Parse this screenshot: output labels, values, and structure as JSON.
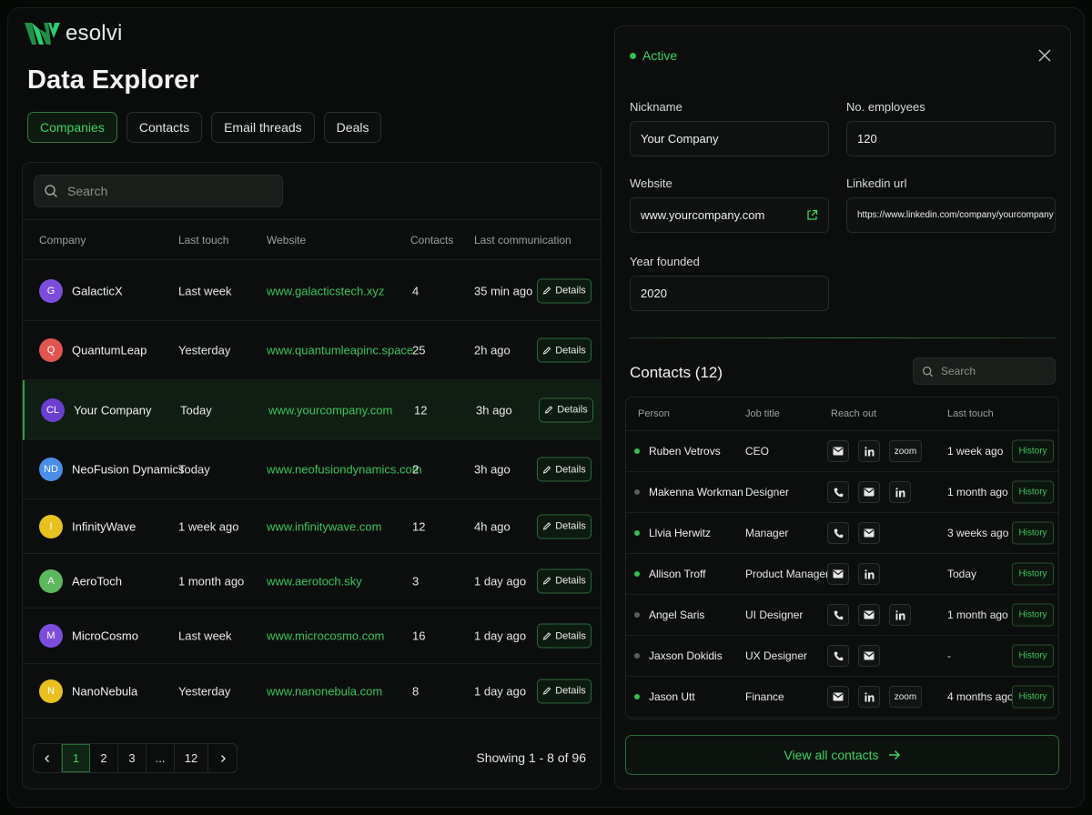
{
  "brand": {
    "name": "esolvi"
  },
  "page": {
    "title": "Data Explorer"
  },
  "tabs": [
    "Companies",
    "Contacts",
    "Email threads",
    "Deals"
  ],
  "table": {
    "search_placeholder": "Search",
    "columns": [
      "Company",
      "Last touch",
      "Website",
      "Contacts",
      "Last communication"
    ],
    "details_label": "Details",
    "rows": [
      {
        "initials": "G",
        "color": "#7c4ddb",
        "name": "GalacticX",
        "last_touch": "Last week",
        "website": "www.galacticstech.xyz",
        "contacts": "4",
        "last_comm": "35 min ago"
      },
      {
        "initials": "Q",
        "color": "#e0554f",
        "name": "QuantumLeap",
        "last_touch": "Yesterday",
        "website": "www.quantumleapinc.space",
        "contacts": "25",
        "last_comm": "2h ago"
      },
      {
        "initials": "CL",
        "color": "#6a3fd0",
        "name": "Your Company",
        "last_touch": "Today",
        "website": "www.yourcompany.com",
        "contacts": "12",
        "last_comm": "3h ago"
      },
      {
        "initials": "ND",
        "color": "#4a8ee8",
        "name": "NeoFusion Dynamics",
        "last_touch": "Today",
        "website": "www.neofusiondynamics.com",
        "contacts": "2",
        "last_comm": "3h ago"
      },
      {
        "initials": "I",
        "color": "#e8c020",
        "name": "InfinityWave",
        "last_touch": "1 week ago",
        "website": "www.infinitywave.com",
        "contacts": "12",
        "last_comm": "4h ago"
      },
      {
        "initials": "A",
        "color": "#5cb85c",
        "name": "AeroToch",
        "last_touch": "1 month ago",
        "website": "www.aerotoch.sky",
        "contacts": "3",
        "last_comm": "1 day ago"
      },
      {
        "initials": "M",
        "color": "#7c4ddb",
        "name": "MicroCosmo",
        "last_touch": "Last week",
        "website": "www.microcosmo.com",
        "contacts": "16",
        "last_comm": "1 day ago"
      },
      {
        "initials": "N",
        "color": "#e8c020",
        "name": "NanoNebula",
        "last_touch": "Yesterday",
        "website": "www.nanonebula.com",
        "contacts": "8",
        "last_comm": "1 day ago"
      }
    ],
    "pagination": {
      "pages": [
        "1",
        "2",
        "3",
        "...",
        "12"
      ],
      "current": "1",
      "showing": "Showing 1 - 8 of 96"
    }
  },
  "detail": {
    "status": "Active",
    "nickname": {
      "label": "Nickname",
      "value": "Your Company"
    },
    "employees": {
      "label": "No. employees",
      "value": "120"
    },
    "website": {
      "label": "Website",
      "value": "www.yourcompany.com"
    },
    "linkedin": {
      "label": "Linkedin url",
      "value": "https://www.linkedin.com/company/yourcompany"
    },
    "founded": {
      "label": "Year founded",
      "value": "2020"
    },
    "contacts_title": "Contacts (12)",
    "contacts_search_placeholder": "Search",
    "contact_columns": [
      "Person",
      "Job title",
      "Reach out",
      "Last touch"
    ],
    "history_label": "History",
    "zoom_label": "zoom",
    "contacts": [
      {
        "name": "Ruben Vetrovs",
        "online": true,
        "title": "CEO",
        "reach": [
          "mail",
          "linkedin",
          "zoom"
        ],
        "last_touch": "1 week ago"
      },
      {
        "name": "Makenna Workman",
        "online": false,
        "title": "Designer",
        "reach": [
          "phone",
          "mail",
          "linkedin"
        ],
        "last_touch": "1 month ago"
      },
      {
        "name": "Llvia Herwitz",
        "online": true,
        "title": "Manager",
        "reach": [
          "phone",
          "mail"
        ],
        "last_touch": "3 weeks ago"
      },
      {
        "name": "Allison Troff",
        "online": true,
        "title": "Product Manager",
        "reach": [
          "mail",
          "linkedin"
        ],
        "last_touch": "Today"
      },
      {
        "name": "Angel Saris",
        "online": false,
        "title": "UI Designer",
        "reach": [
          "phone",
          "mail",
          "linkedin"
        ],
        "last_touch": "1 month ago"
      },
      {
        "name": "Jaxson Dokidis",
        "online": false,
        "title": "UX Designer",
        "reach": [
          "phone",
          "mail"
        ],
        "last_touch": "-"
      },
      {
        "name": "Jason Utt",
        "online": true,
        "title": "Finance",
        "reach": [
          "mail",
          "linkedin",
          "zoom"
        ],
        "last_touch": "4 months ago"
      }
    ],
    "view_all": "View all contacts"
  },
  "colors": {
    "accent": "#3fd161",
    "online": "#2fc150",
    "offline": "#5a5f5b"
  }
}
